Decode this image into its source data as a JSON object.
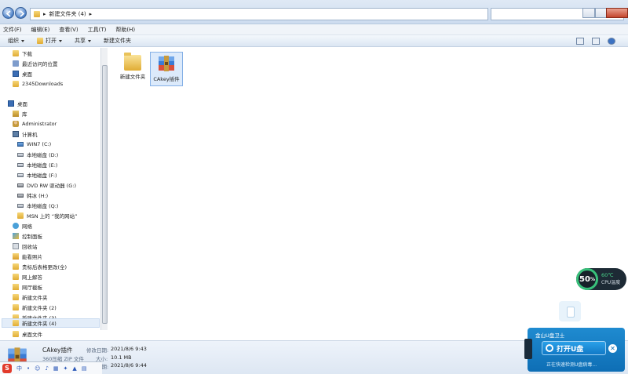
{
  "window": {
    "address_path": "新建文件夹 (4)",
    "address_sep": "▸"
  },
  "menu": [
    "文件(F)",
    "编辑(E)",
    "查看(V)",
    "工具(T)",
    "帮助(H)"
  ],
  "toolbar": {
    "organize": "组织",
    "open": "打开",
    "share": "共享",
    "new_folder": "新建文件夹"
  },
  "nav": {
    "favorites": [
      "下载",
      "最近访问的位置",
      "桌面",
      "2345Downloads"
    ],
    "desktop_root": "桌面",
    "tree": [
      "库",
      "Administrator",
      "计算机",
      "WIN7 (C:)",
      "本地磁盘 (D:)",
      "本地磁盘 (E:)",
      "本地磁盘 (F:)",
      "DVD RW 驱动器 (G:)",
      "韩冰 (H:)",
      "本地磁盘 (Q:)",
      "MSN 上的 “我的网站”",
      "网络",
      "控制面板",
      "回收站",
      "能看照片",
      "贵标后表格更改(全)",
      "网上解答",
      "网厅截板",
      "新建文件夹",
      "新建文件夹 (2)",
      "新建文件夹 (3)",
      "新建文件夹 (4)",
      "桌面文件"
    ]
  },
  "files": [
    {
      "label": "新建文件夹"
    },
    {
      "label": "CAkey插件"
    }
  ],
  "details": {
    "name": "CAkey插件",
    "type": "360压缩 ZIP 文件",
    "modified_key": "修改日期:",
    "modified": "2021/8/6 9:43",
    "size_key": "大小:",
    "size": "10.1 MB",
    "created_key": "创建日期:",
    "created": "2021/8/6 9:44"
  },
  "ime": {
    "lang": "中"
  },
  "cpu_widget": {
    "usage": "50",
    "usage_unit": "%",
    "temp": "60℃",
    "label": "CPU温度"
  },
  "usb_popup": {
    "title": "金山U盘卫士",
    "button": "打开U盘",
    "close": "✕",
    "status": "正在快速检测U盘病毒..."
  },
  "colors": {
    "accent": "#1f8bd0",
    "selection": "#dceafb"
  }
}
